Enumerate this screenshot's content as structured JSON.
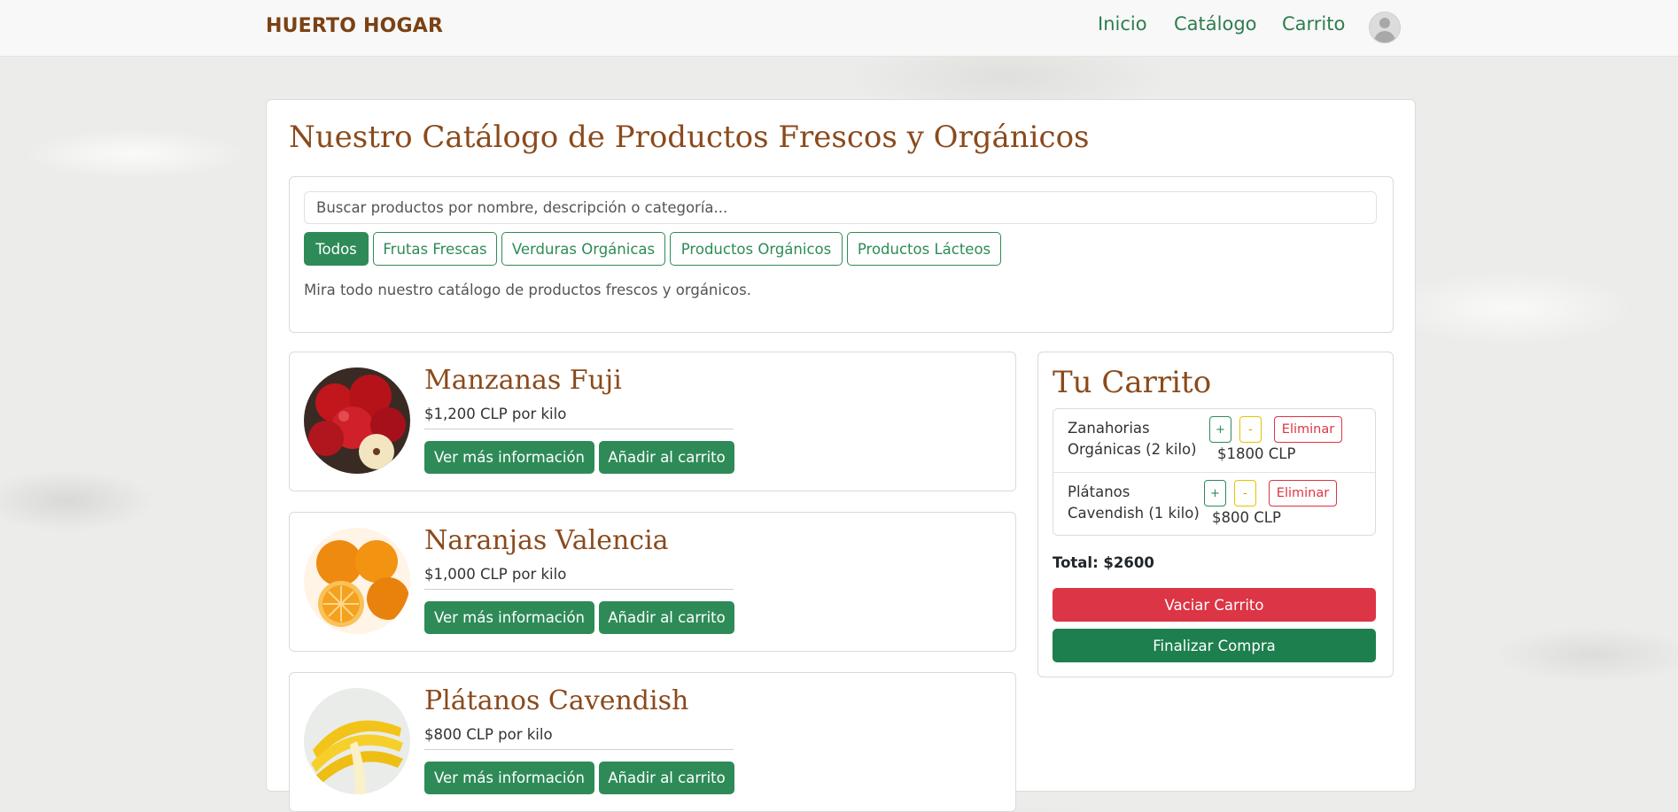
{
  "nav": {
    "brand": "HUERTO HOGAR",
    "links": [
      "Inicio",
      "Catálogo",
      "Carrito"
    ],
    "avatar_icon": "user-avatar-icon"
  },
  "page": {
    "title": "Nuestro Catálogo de Productos Frescos y Orgánicos"
  },
  "filters": {
    "search_placeholder": "Buscar productos por nombre, descripción o categoría...",
    "categories": [
      "Todos",
      "Frutas Frescas",
      "Verduras Orgánicas",
      "Productos Orgánicos",
      "Productos Lácteos"
    ],
    "active_category": "Todos",
    "description": "Mira todo nuestro catálogo de productos frescos y orgánicos."
  },
  "products": [
    {
      "name": "Manzanas Fuji",
      "price": "$1,200 CLP por kilo",
      "info_label": "Ver más información",
      "add_label": "Añadir al carrito"
    },
    {
      "name": "Naranjas Valencia",
      "price": "$1,000 CLP por kilo",
      "info_label": "Ver más información",
      "add_label": "Añadir al carrito"
    },
    {
      "name": "Plátanos Cavendish",
      "price": "$800 CLP por kilo",
      "info_label": "Ver más información",
      "add_label": "Añadir al carrito"
    }
  ],
  "cart": {
    "title": "Tu Carrito",
    "items": [
      {
        "name": "Zanahorias Orgánicas (2 kilo)",
        "price": "$1800 CLP",
        "plus": "+",
        "minus": "-",
        "remove": "Eliminar"
      },
      {
        "name": "Plátanos Cavendish (1 kilo)",
        "price": "$800 CLP",
        "plus": "+",
        "minus": "-",
        "remove": "Eliminar"
      }
    ],
    "total": "Total: $2600",
    "clear_label": "Vaciar Carrito",
    "checkout_label": "Finalizar Compra"
  },
  "colors": {
    "brand_brown": "#8b4a1c",
    "accent_green": "#2e8b57",
    "danger_red": "#dc3545",
    "warning_yellow": "#e6c200"
  }
}
